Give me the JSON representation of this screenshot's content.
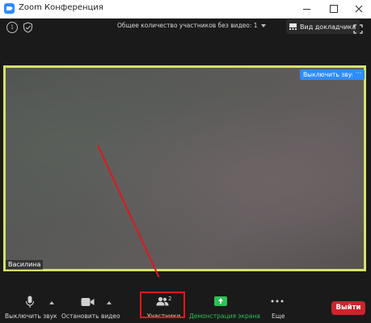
{
  "window": {
    "title": "Zoom Конференция"
  },
  "topbar": {
    "participants_without_video": "Общее количество участников без видео: 1",
    "speaker_view_label": "Вид докладчика"
  },
  "video": {
    "mute_button_label": "Выключить звук",
    "more_button_label": "···",
    "participant_name": "Василина"
  },
  "toolbar": {
    "mute_label": "Выключить звук",
    "stop_video_label": "Остановить видео",
    "participants_label": "Участники",
    "participants_count": "2",
    "share_label": "Демонстрация экрана",
    "more_label": "Еще",
    "leave_label": "Выйти"
  },
  "colors": {
    "accent_blue": "#2d8cff",
    "share_green": "#2fbf57",
    "leave_red": "#c8262d",
    "active_speaker_border": "#d6e06a",
    "annotation_red": "#e2161c"
  },
  "icons": [
    "zoom-logo-icon",
    "info-icon",
    "shield-icon",
    "grid-icon",
    "fullscreen-icon",
    "microphone-icon",
    "video-camera-icon",
    "participants-icon",
    "share-screen-icon",
    "more-dots-icon",
    "minimize-icon",
    "maximize-icon",
    "close-icon",
    "annotation-arrow"
  ]
}
